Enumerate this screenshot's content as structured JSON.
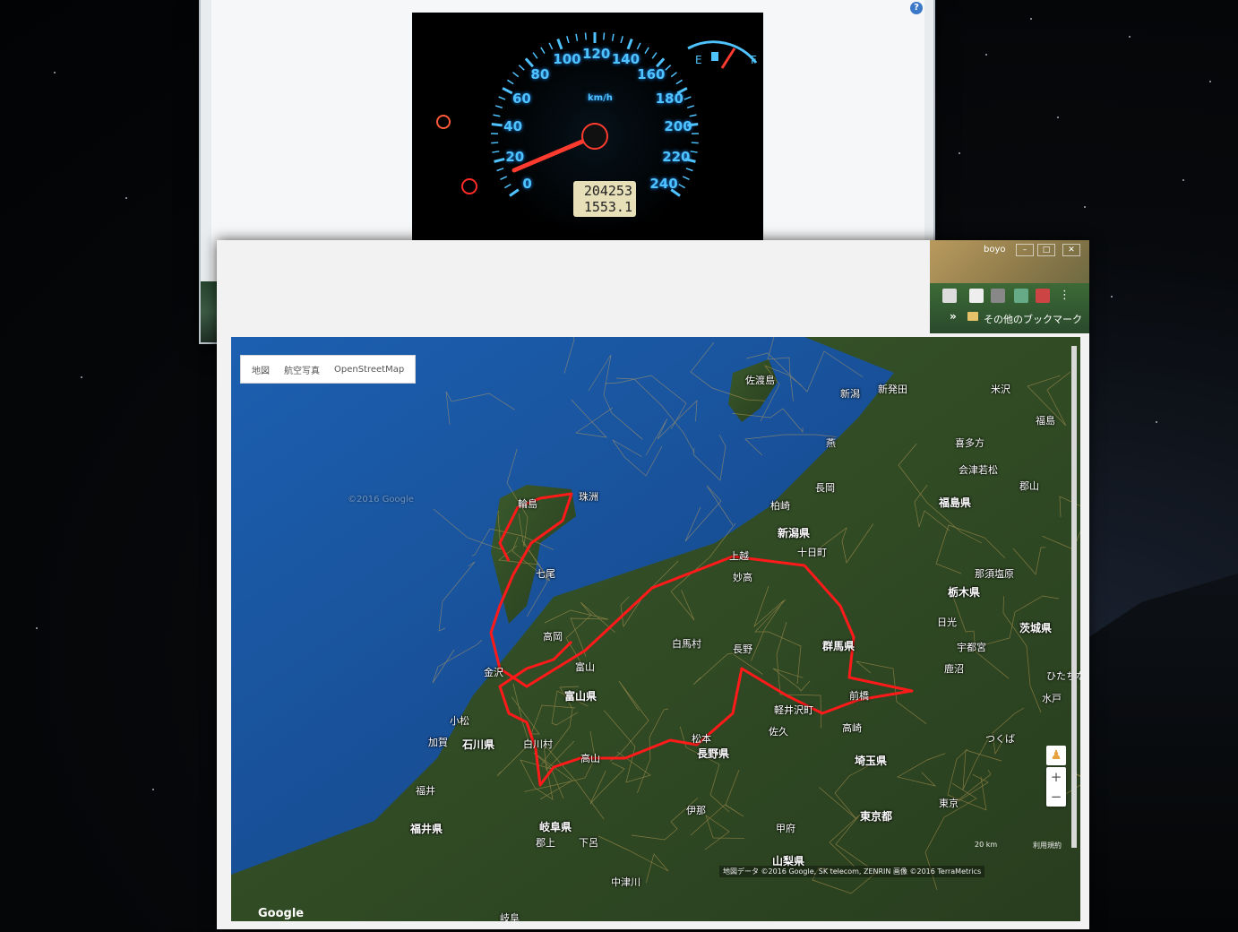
{
  "viewer": {
    "help_icon": "?",
    "photo": {
      "speed_labels": [
        "0",
        "20",
        "40",
        "60",
        "80",
        "100",
        "120",
        "140",
        "160",
        "180",
        "200",
        "220",
        "240"
      ],
      "unit": "km/h",
      "odometer": "204253",
      "trip": "1553.1",
      "fuel_empty": "E",
      "fuel_full": "F"
    },
    "toolbar": {
      "icons": [
        "zoom-icon",
        "fit-icon",
        "previous-icon",
        "slideshow-icon",
        "next-icon",
        "rotate-left-icon",
        "rotate-right-icon",
        "delete-icon"
      ]
    }
  },
  "browser": {
    "user": "boyo",
    "bookmarks_more": "»",
    "bookmarks_folder": "その他のブックマーク",
    "map_types": [
      "地図",
      "航空写真",
      "OpenStreetMap"
    ],
    "zoom_in": "+",
    "zoom_out": "−",
    "attribution": "地図データ ©2016 Google, SK telecom, ZENRIN 画像 ©2016 TerraMetrics",
    "scale": "20 km",
    "terms": "利用規約",
    "google_logo": "Google",
    "watermark": "©2016 Google"
  },
  "map_labels": {
    "places": [
      "佐渡島",
      "新潟",
      "新発田",
      "米沢",
      "福島",
      "喜多方",
      "会津若松",
      "燕",
      "長岡",
      "柏崎",
      "上越",
      "十日町",
      "妙高",
      "那須塩原",
      "日光",
      "宇都宮",
      "鹿沼",
      "ひたちな",
      "水戸",
      "つくば",
      "前橋",
      "高崎",
      "軽井沢町",
      "佐久",
      "長野",
      "白馬村",
      "松本",
      "輪島",
      "珠洲",
      "七尾",
      "高岡",
      "富山",
      "金沢",
      "小松",
      "加賀",
      "福井",
      "白川村",
      "高山",
      "郡上",
      "下呂",
      "中津川",
      "伊那",
      "甲府",
      "東京",
      "岐阜",
      "郡山"
    ],
    "prefectures": [
      "新潟県",
      "福島県",
      "栃木県",
      "群馬県",
      "茨城県",
      "長野県",
      "埼玉県",
      "東京都",
      "富山県",
      "石川県",
      "福井県",
      "岐阜県",
      "山梨県"
    ]
  },
  "colors": {
    "route": "#ff1a1a",
    "sea": "#1c4c92",
    "land": "#2d4a26",
    "dial": "#4fc3ff"
  }
}
